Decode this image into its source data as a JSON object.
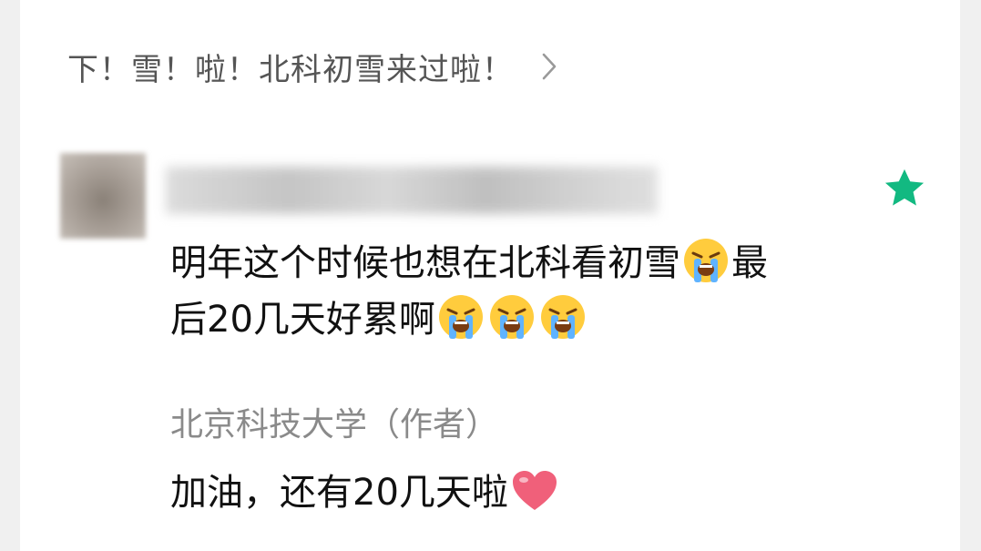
{
  "article": {
    "title": "下！雪！啦！北科初雪来过啦！",
    "chevron_icon": "chevron-right-icon"
  },
  "comment": {
    "avatar_icon": "avatar-blurred",
    "favorite_icon": "star-icon",
    "favorite_color": "#12b981",
    "text_line1": "明年这个时候也想在北科看初雪",
    "emoji1": "loudly-crying-face-icon",
    "text_line1_end": "最",
    "text_line2": "后20几天好累啊",
    "emoji_repeat": [
      "loudly-crying-face-icon",
      "loudly-crying-face-icon",
      "loudly-crying-face-icon"
    ]
  },
  "reply": {
    "author": "北京科技大学（作者）",
    "text": "加油，还有20几天啦",
    "heart_icon": "heart-icon",
    "heart_color": "#f0607a"
  }
}
